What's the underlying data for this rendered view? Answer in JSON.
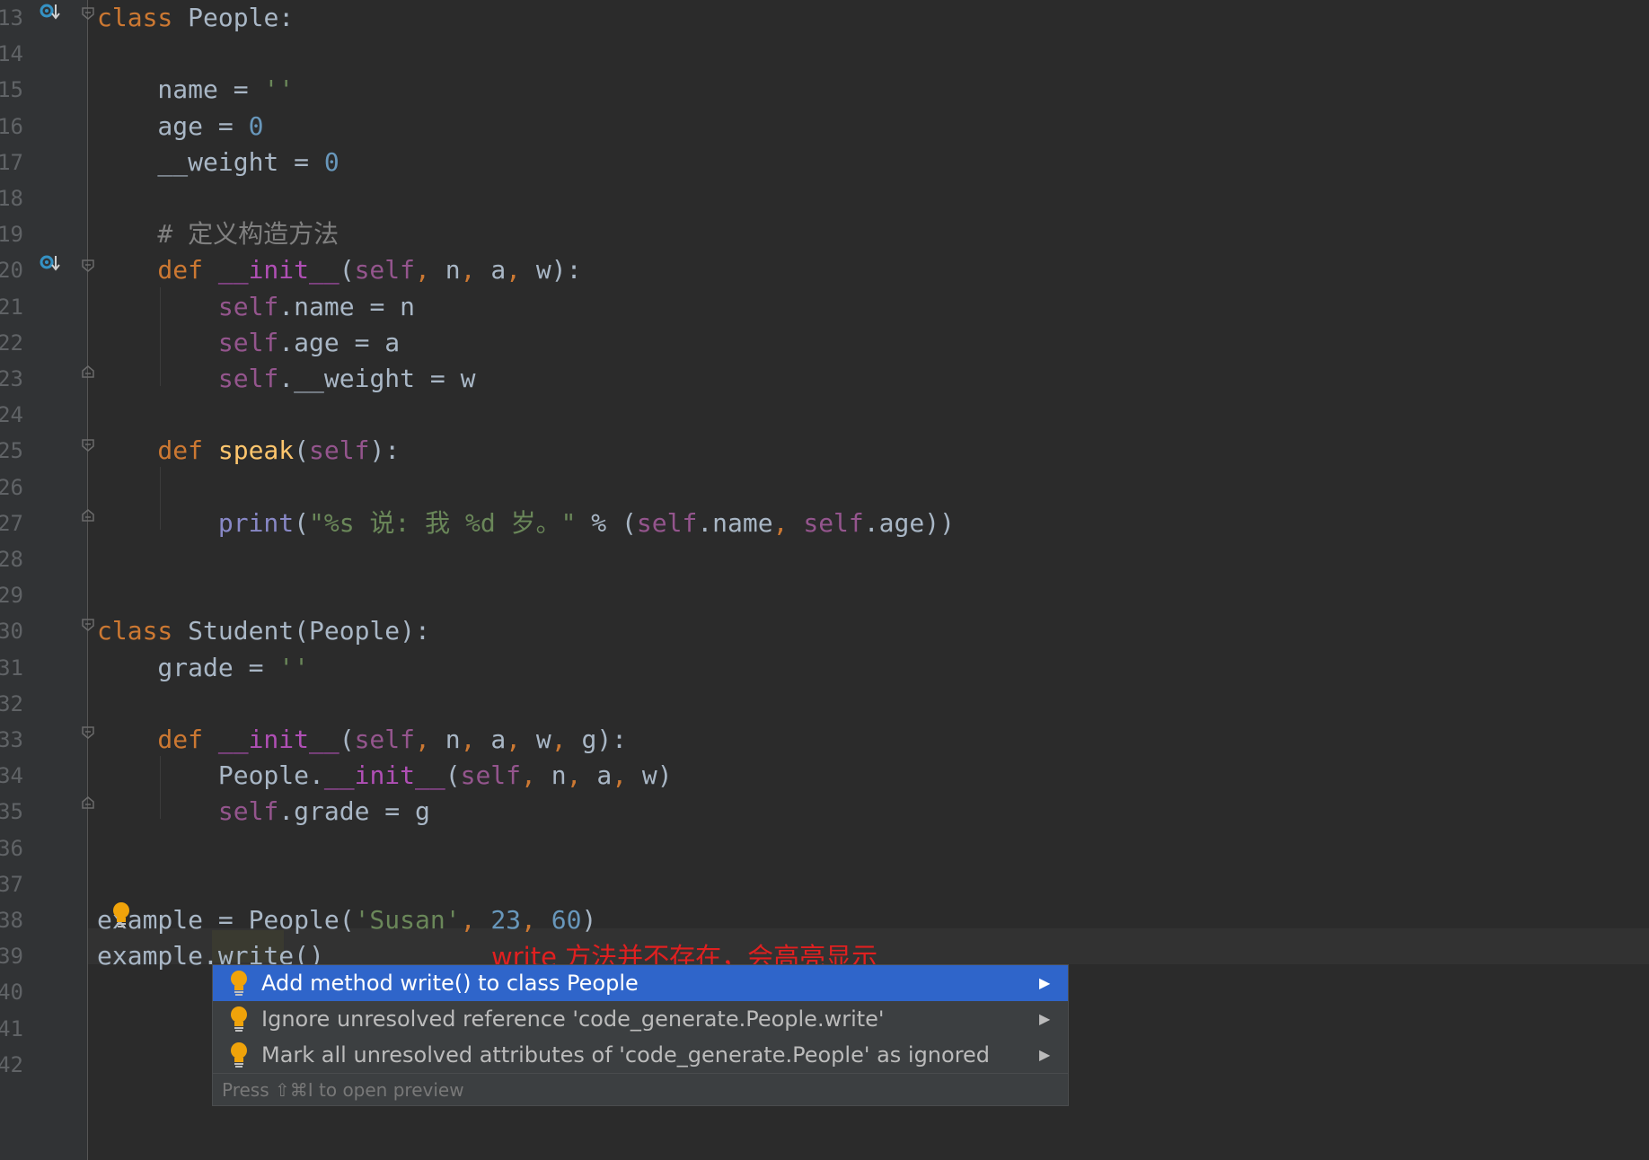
{
  "editor": {
    "lines": [
      {
        "number": "13",
        "tokens": [
          {
            "t": "class",
            "c": "kw"
          },
          {
            "t": " People:",
            "c": "punct"
          }
        ]
      },
      {
        "number": "14",
        "tokens": []
      },
      {
        "number": "15",
        "tokens": [
          {
            "t": "    name = ",
            "c": "punct"
          },
          {
            "t": "''",
            "c": "str"
          }
        ]
      },
      {
        "number": "16",
        "tokens": [
          {
            "t": "    age = ",
            "c": "punct"
          },
          {
            "t": "0",
            "c": "num"
          }
        ]
      },
      {
        "number": "17",
        "tokens": [
          {
            "t": "    __weight = ",
            "c": "punct"
          },
          {
            "t": "0",
            "c": "num"
          }
        ]
      },
      {
        "number": "18",
        "tokens": []
      },
      {
        "number": "19",
        "tokens": [
          {
            "t": "    # 定义构造方法",
            "c": "cmt"
          }
        ]
      },
      {
        "number": "20",
        "tokens": [
          {
            "t": "    def ",
            "c": "kw"
          },
          {
            "t": "__init__",
            "c": "magic"
          },
          {
            "t": "(",
            "c": "punct"
          },
          {
            "t": "self",
            "c": "self"
          },
          {
            "t": ", ",
            "c": "comma"
          },
          {
            "t": "n",
            "c": "punct"
          },
          {
            "t": ", ",
            "c": "comma"
          },
          {
            "t": "a",
            "c": "punct"
          },
          {
            "t": ", ",
            "c": "comma"
          },
          {
            "t": "w):",
            "c": "punct"
          }
        ]
      },
      {
        "number": "21",
        "tokens": [
          {
            "t": "        ",
            "c": "punct"
          },
          {
            "t": "self",
            "c": "self"
          },
          {
            "t": ".name = n",
            "c": "punct"
          }
        ]
      },
      {
        "number": "22",
        "tokens": [
          {
            "t": "        ",
            "c": "punct"
          },
          {
            "t": "self",
            "c": "self"
          },
          {
            "t": ".age = a",
            "c": "punct"
          }
        ]
      },
      {
        "number": "23",
        "tokens": [
          {
            "t": "        ",
            "c": "punct"
          },
          {
            "t": "self",
            "c": "self"
          },
          {
            "t": ".__weight = w",
            "c": "punct"
          }
        ]
      },
      {
        "number": "24",
        "tokens": []
      },
      {
        "number": "25",
        "tokens": [
          {
            "t": "    def ",
            "c": "kw"
          },
          {
            "t": "speak",
            "c": "fn"
          },
          {
            "t": "(",
            "c": "punct"
          },
          {
            "t": "self",
            "c": "self"
          },
          {
            "t": "):",
            "c": "punct"
          }
        ]
      },
      {
        "number": "26",
        "tokens": []
      },
      {
        "number": "27",
        "tokens": [
          {
            "t": "        ",
            "c": "punct"
          },
          {
            "t": "print",
            "c": "builtin"
          },
          {
            "t": "(",
            "c": "punct"
          },
          {
            "t": "\"%s 说: 我 %d 岁。\"",
            "c": "str"
          },
          {
            "t": " % (",
            "c": "punct"
          },
          {
            "t": "self",
            "c": "self"
          },
          {
            "t": ".name",
            "c": "punct"
          },
          {
            "t": ", ",
            "c": "comma"
          },
          {
            "t": "self",
            "c": "self"
          },
          {
            "t": ".age))",
            "c": "punct"
          }
        ]
      },
      {
        "number": "28",
        "tokens": []
      },
      {
        "number": "29",
        "tokens": []
      },
      {
        "number": "30",
        "tokens": [
          {
            "t": "class",
            "c": "kw"
          },
          {
            "t": " Student(People):",
            "c": "punct"
          }
        ]
      },
      {
        "number": "31",
        "tokens": [
          {
            "t": "    grade = ",
            "c": "punct"
          },
          {
            "t": "''",
            "c": "str"
          }
        ]
      },
      {
        "number": "32",
        "tokens": []
      },
      {
        "number": "33",
        "tokens": [
          {
            "t": "    def ",
            "c": "kw"
          },
          {
            "t": "__init__",
            "c": "magic"
          },
          {
            "t": "(",
            "c": "punct"
          },
          {
            "t": "self",
            "c": "self"
          },
          {
            "t": ", ",
            "c": "comma"
          },
          {
            "t": "n",
            "c": "punct"
          },
          {
            "t": ", ",
            "c": "comma"
          },
          {
            "t": "a",
            "c": "punct"
          },
          {
            "t": ", ",
            "c": "comma"
          },
          {
            "t": "w",
            "c": "punct"
          },
          {
            "t": ", ",
            "c": "comma"
          },
          {
            "t": "g):",
            "c": "punct"
          }
        ]
      },
      {
        "number": "34",
        "tokens": [
          {
            "t": "        People.",
            "c": "punct"
          },
          {
            "t": "__init__",
            "c": "magic"
          },
          {
            "t": "(",
            "c": "punct"
          },
          {
            "t": "self",
            "c": "self"
          },
          {
            "t": ", ",
            "c": "comma"
          },
          {
            "t": "n",
            "c": "punct"
          },
          {
            "t": ", ",
            "c": "comma"
          },
          {
            "t": "a",
            "c": "punct"
          },
          {
            "t": ", ",
            "c": "comma"
          },
          {
            "t": "w)",
            "c": "punct"
          }
        ]
      },
      {
        "number": "35",
        "tokens": [
          {
            "t": "        ",
            "c": "punct"
          },
          {
            "t": "self",
            "c": "self"
          },
          {
            "t": ".grade = g",
            "c": "punct"
          }
        ]
      },
      {
        "number": "36",
        "tokens": []
      },
      {
        "number": "37",
        "tokens": []
      },
      {
        "number": "38",
        "tokens": [
          {
            "t": "example = People(",
            "c": "punct"
          },
          {
            "t": "'Susan'",
            "c": "str"
          },
          {
            "t": ", ",
            "c": "comma"
          },
          {
            "t": "23",
            "c": "num"
          },
          {
            "t": ", ",
            "c": "comma"
          },
          {
            "t": "60",
            "c": "num"
          },
          {
            "t": ")",
            "c": "punct"
          }
        ]
      },
      {
        "number": "39",
        "tokens": [
          {
            "t": "example.write()",
            "c": "punct"
          }
        ]
      },
      {
        "number": "40",
        "tokens": []
      },
      {
        "number": "41",
        "tokens": []
      },
      {
        "number": "42",
        "tokens": []
      }
    ]
  },
  "annotation": "write 方法并不存在，会高亮显示",
  "intention_popup": {
    "items": [
      {
        "label": "Add method write() to class People",
        "selected": true,
        "icon": "lightbulb-icon"
      },
      {
        "label": "Ignore unresolved reference 'code_generate.People.write'",
        "selected": false,
        "icon": "lightbulb-icon"
      },
      {
        "label": "Mark all unresolved attributes of 'code_generate.People' as ignored",
        "selected": false,
        "icon": "lightbulb-icon"
      }
    ],
    "footer": "Press ⇧⌘I to open preview"
  },
  "colors": {
    "background": "#2b2b2b",
    "keyword": "#cc7832",
    "string": "#6a8759",
    "number": "#6897bb",
    "self": "#94558d",
    "annotation": "#e02020",
    "selection": "#2f65ca"
  }
}
